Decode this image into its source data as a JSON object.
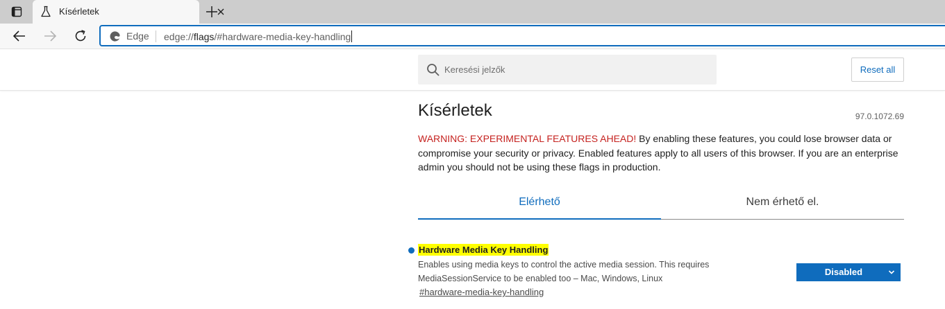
{
  "browser": {
    "tab": {
      "title": "Kísérletek",
      "icon": "flask-icon"
    },
    "omnibox": {
      "identity_label": "Edge",
      "url_scheme": "edge://",
      "url_host": "flags",
      "url_path": "/#hardware-media-key-handling"
    }
  },
  "header": {
    "search_placeholder": "Keresési jelzők",
    "reset_label": "Reset all"
  },
  "main": {
    "title": "Kísérletek",
    "version": "97.0.1072.69",
    "warning_prefix": "WARNING: EXPERIMENTAL FEATURES AHEAD!",
    "warning_body": " By enabling these features, you could lose browser data or compromise your security or privacy. Enabled features apply to all users of this browser. If you are an enterprise admin you should not be using these flags in production.",
    "tabs": [
      {
        "label": "Elérhető",
        "selected": true
      },
      {
        "label": "Nem érhető el.",
        "selected": false
      }
    ]
  },
  "experiment": {
    "name": "Hardware Media Key Handling",
    "description": "Enables using media keys to control the active media session. This requires MediaSessionService to be enabled too – Mac, Windows, Linux",
    "link": "#hardware-media-key-handling",
    "selected_value": "Disabled"
  },
  "colors": {
    "accent": "#0f6cbd",
    "warning": "#c5221f",
    "highlight": "#ffff00"
  }
}
